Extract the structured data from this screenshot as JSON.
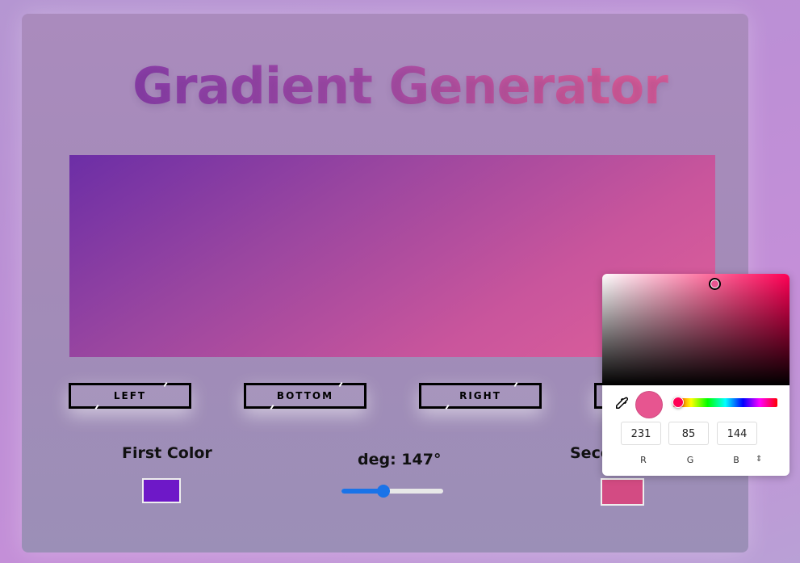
{
  "app": {
    "title": "Gradient Generator"
  },
  "gradient": {
    "color_from": "#6c2ea6",
    "color_to": "#e0609a",
    "angle_deg": 147
  },
  "directions": [
    {
      "label": "LEFT"
    },
    {
      "label": "BOTTOM"
    },
    {
      "label": "RIGHT"
    }
  ],
  "first_color": {
    "label": "First Color",
    "hex": "#6e18c8"
  },
  "angle_control": {
    "label": "deg: 147°",
    "value_fraction": 0.41
  },
  "second_color": {
    "label": "Seco",
    "hex": "#d34b83"
  },
  "color_picker": {
    "hue_color": "#ff0055",
    "current_hex": "#e75590",
    "hue_fraction": 0.05,
    "saturation_fraction": 0.6,
    "value_fraction": 0.91,
    "inputs": [
      {
        "value": "231",
        "label": "R"
      },
      {
        "value": "85",
        "label": "G"
      },
      {
        "value": "144",
        "label": "B"
      }
    ],
    "mode_toggle_icon": "⇕"
  }
}
